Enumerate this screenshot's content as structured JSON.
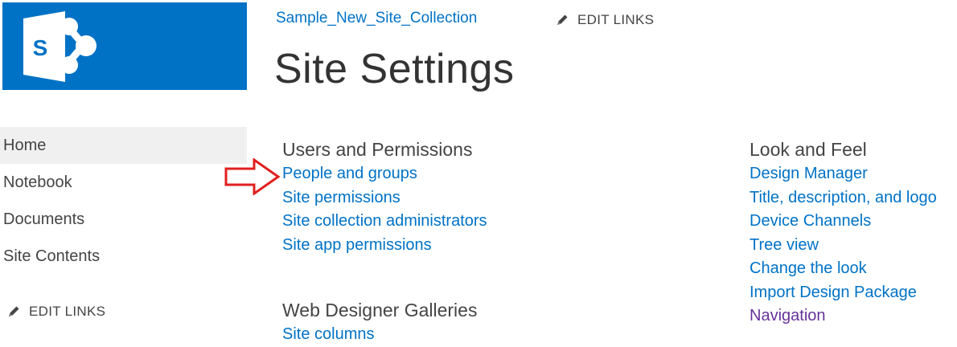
{
  "header": {
    "site_collection_link": "Sample_New_Site_Collection",
    "edit_links_label": "EDIT LINKS",
    "page_title": "Site Settings",
    "logo_letter": "S"
  },
  "quicklaunch": {
    "items": [
      {
        "label": "Home",
        "selected": true
      },
      {
        "label": "Notebook"
      },
      {
        "label": "Documents"
      },
      {
        "label": "Site Contents"
      }
    ],
    "edit_links_label": "EDIT LINKS"
  },
  "groups": {
    "users_permissions": {
      "title": "Users and Permissions",
      "links": [
        "People and groups",
        "Site permissions",
        "Site collection administrators",
        "Site app permissions"
      ]
    },
    "web_designer_galleries": {
      "title": "Web Designer Galleries",
      "links": [
        "Site columns"
      ]
    },
    "look_and_feel": {
      "title": "Look and Feel",
      "links": [
        "Design Manager",
        "Title, description, and logo",
        "Device Channels",
        "Tree view",
        "Change the look",
        "Import Design Package",
        "Navigation"
      ]
    }
  },
  "colors": {
    "brand_blue": "#0072c6",
    "visited_link": "#663399",
    "annotation_arrow": "#e02020"
  },
  "icons": [
    "sharepoint-logo-icon",
    "pencil-icon",
    "red-arrow-icon"
  ]
}
